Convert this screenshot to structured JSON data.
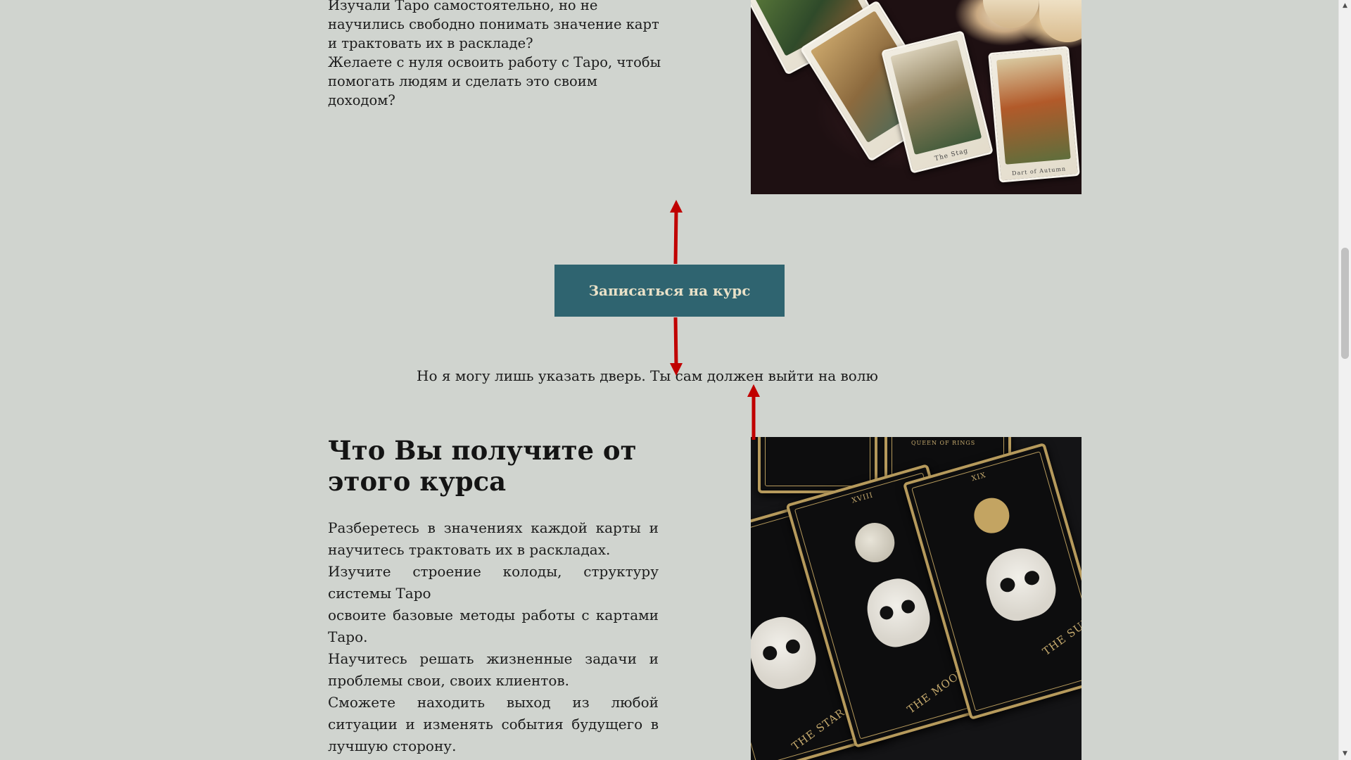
{
  "intro": {
    "paragraphs": [
      "Изучали Таро самостоятельно, но не научились свободно понимать значение карт и трактовать их в раскладе?",
      "Желаете с нуля освоить работу с Таро, чтобы помогать людям и сделать это своим доходом?"
    ]
  },
  "cta": {
    "label": "Записаться на курс"
  },
  "quote": {
    "text": "Но я могу лишь указать дверь. Ты сам должен выйти на волю"
  },
  "section": {
    "title": "Что Вы получите от этого курса",
    "benefits": [
      "Разберетесь в значениях каждой карты и научитесь трактовать их в раскладах.",
      "Изучите строение колоды, структуру системы Таро",
      "освоите базовые методы работы с картами Таро.",
      "Научитесь решать жизненные задачи и проблемы свои, своих клиентов.",
      "Сможете находить выход из любой ситуации и изменять события будущего в лучшую сторону."
    ]
  },
  "images": {
    "top": {
      "card_captions": [
        "The Stag",
        "Dart of Autumn"
      ]
    },
    "bottom": {
      "card_captions": [
        "QUEEN OF RINGS",
        "THE STAR",
        "THE MOON",
        "THE SUN",
        "XVIII",
        "XIX"
      ]
    }
  },
  "colors": {
    "background": "#d0d4cf",
    "button": "#2f6470",
    "button_text": "#e9e1c8",
    "arrow": "#c00000",
    "card_gold": "#b69a5c"
  },
  "icons": {
    "scroll_up": "▲",
    "scroll_down": "▼"
  }
}
